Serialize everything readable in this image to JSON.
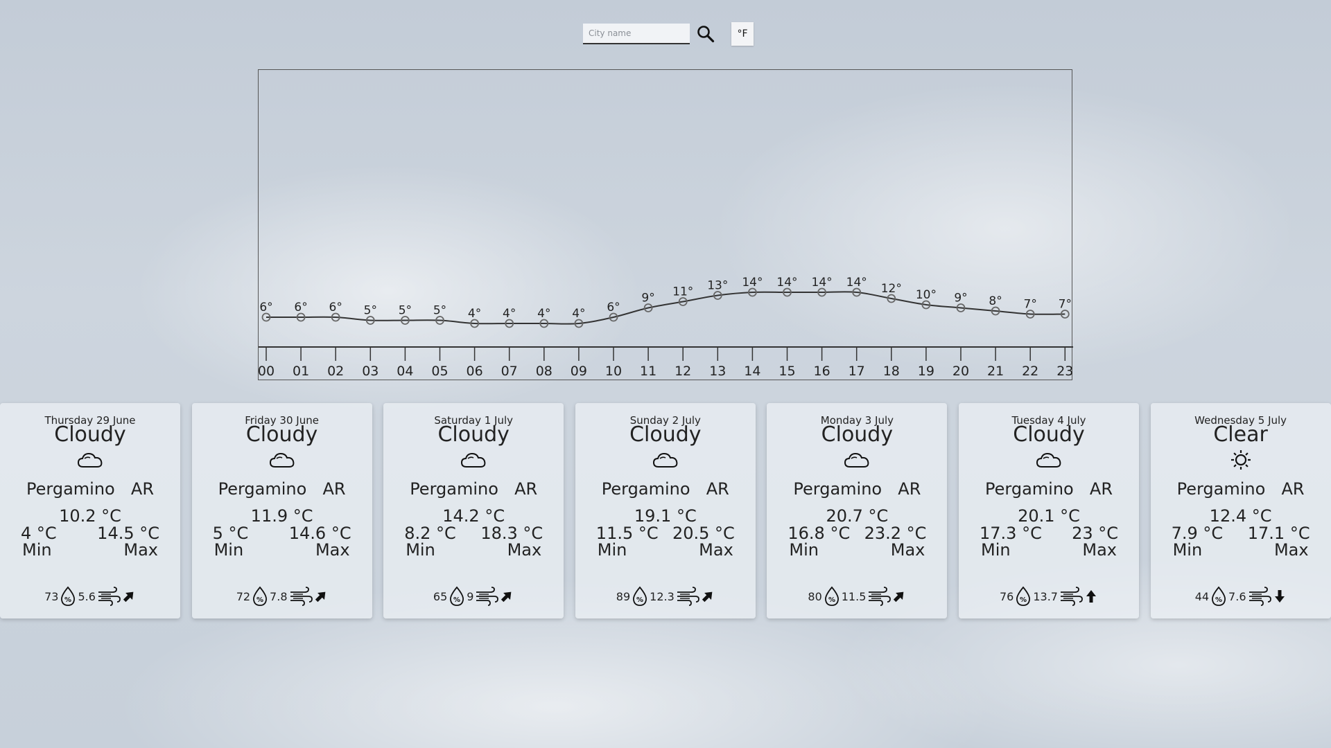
{
  "search": {
    "placeholder": "City name"
  },
  "unit_toggle": {
    "label": "°F"
  },
  "chart_data": {
    "type": "line",
    "x": [
      "00",
      "01",
      "02",
      "03",
      "04",
      "05",
      "06",
      "07",
      "08",
      "09",
      "10",
      "11",
      "12",
      "13",
      "14",
      "15",
      "16",
      "17",
      "18",
      "19",
      "20",
      "21",
      "22",
      "23"
    ],
    "series": [
      {
        "values": [
          6,
          6,
          6,
          5,
          5,
          5,
          4,
          4,
          4,
          4,
          6,
          9,
          11,
          13,
          14,
          14,
          14,
          14,
          12,
          10,
          9,
          8,
          7,
          7
        ]
      }
    ],
    "value_suffix": "°",
    "grid": false,
    "colors": {
      "line": "#333333",
      "marker": "#666666"
    }
  },
  "forecast": [
    {
      "date": "Thursday 29 June",
      "condition": "Cloudy",
      "icon": "cloud-icon",
      "city": "Pergamino",
      "country": "AR",
      "temp": "10.2 °C",
      "min": "4 °C",
      "max": "14.5 °C",
      "min_label": "Min",
      "max_label": "Max",
      "humidity": "73",
      "wind": "5.6",
      "wind_dir_deg": 45
    },
    {
      "date": "Friday 30 June",
      "condition": "Cloudy",
      "icon": "cloud-icon",
      "city": "Pergamino",
      "country": "AR",
      "temp": "11.9 °C",
      "min": "5 °C",
      "max": "14.6 °C",
      "min_label": "Min",
      "max_label": "Max",
      "humidity": "72",
      "wind": "7.8",
      "wind_dir_deg": 45
    },
    {
      "date": "Saturday 1 July",
      "condition": "Cloudy",
      "icon": "cloud-icon",
      "city": "Pergamino",
      "country": "AR",
      "temp": "14.2 °C",
      "min": "8.2 °C",
      "max": "18.3 °C",
      "min_label": "Min",
      "max_label": "Max",
      "humidity": "65",
      "wind": "9",
      "wind_dir_deg": 45
    },
    {
      "date": "Sunday 2 July",
      "condition": "Cloudy",
      "icon": "cloud-icon",
      "city": "Pergamino",
      "country": "AR",
      "temp": "19.1 °C",
      "min": "11.5 °C",
      "max": "20.5 °C",
      "min_label": "Min",
      "max_label": "Max",
      "humidity": "89",
      "wind": "12.3",
      "wind_dir_deg": 45
    },
    {
      "date": "Monday 3 July",
      "condition": "Cloudy",
      "icon": "cloud-icon",
      "city": "Pergamino",
      "country": "AR",
      "temp": "20.7 °C",
      "min": "16.8 °C",
      "max": "23.2 °C",
      "min_label": "Min",
      "max_label": "Max",
      "humidity": "80",
      "wind": "11.5",
      "wind_dir_deg": 45
    },
    {
      "date": "Tuesday 4 July",
      "condition": "Cloudy",
      "icon": "cloud-icon",
      "city": "Pergamino",
      "country": "AR",
      "temp": "20.1 °C",
      "min": "17.3 °C",
      "max": "23 °C",
      "min_label": "Min",
      "max_label": "Max",
      "humidity": "76",
      "wind": "13.7",
      "wind_dir_deg": 0
    },
    {
      "date": "Wednesday 5 July",
      "condition": "Clear",
      "icon": "sun-icon",
      "city": "Pergamino",
      "country": "AR",
      "temp": "12.4 °C",
      "min": "7.9 °C",
      "max": "17.1 °C",
      "min_label": "Min",
      "max_label": "Max",
      "humidity": "44",
      "wind": "7.6",
      "wind_dir_deg": 180
    }
  ]
}
